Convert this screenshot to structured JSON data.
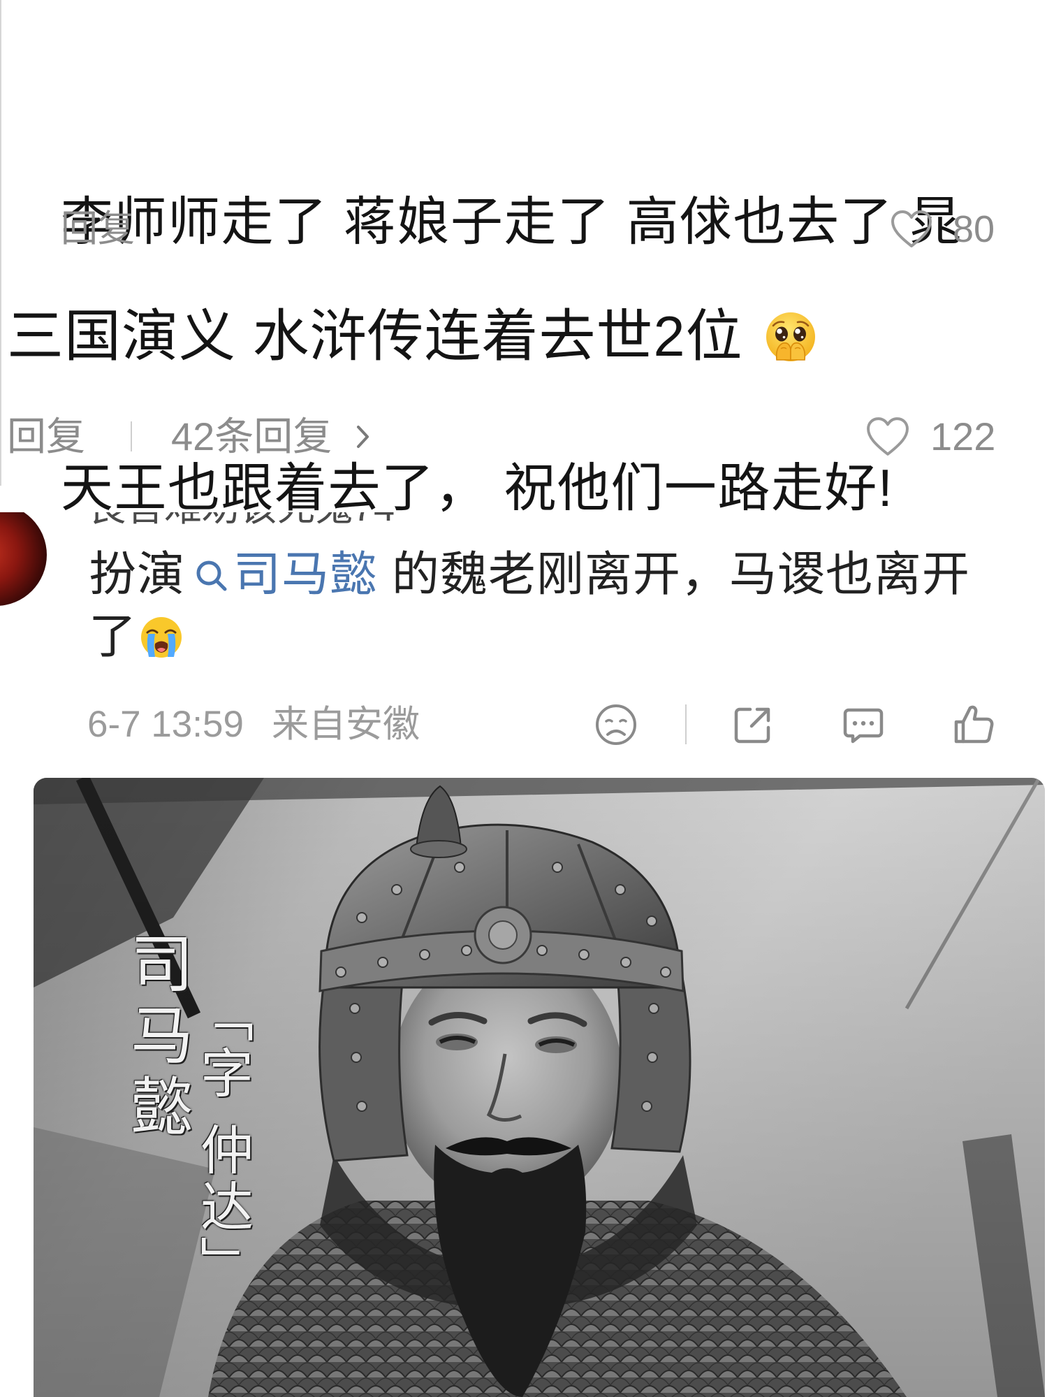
{
  "colors": {
    "text_primary": "#141414",
    "text_post": "#222222",
    "muted": "#8c8c8c",
    "meta": "#9b9b9b",
    "icon": "#8a8a8a",
    "link": "#4a76b0"
  },
  "comment1": {
    "lines": [
      "李师师走了 蒋娘子走了 高俅也去了 晁",
      "天王也跟着去了， 祝他们一路走好!"
    ],
    "reply_label": "回复",
    "like_icon": "heart-outline-icon",
    "like_count": "80"
  },
  "comment2": {
    "text": "三国演义 水浒传连着去世2位",
    "emoji": "pleading-face-hands-over-mouth",
    "reply_label": "回复",
    "reply_count_label": "42条回复",
    "chevron_icon": "chevron-right-icon",
    "like_icon": "heart-outline-icon",
    "like_count": "122"
  },
  "post": {
    "username": "良言难劝该死鬼74",
    "text_prefix": "扮演",
    "topic_icon": "search-icon",
    "topic_link": "司马懿",
    "text_suffix": " 的魏老刚离开，马谡也离开",
    "text_line2": "了",
    "emoji": "loudly-crying-face",
    "time": "6-7 13:59",
    "source": "来自安徽",
    "actions": [
      "sad-face-icon",
      "share-icon",
      "comment-icon",
      "thumbs-up-icon"
    ],
    "photo": {
      "caption_name": "司马懿",
      "caption_courtesy": "「字 仲达」"
    }
  }
}
